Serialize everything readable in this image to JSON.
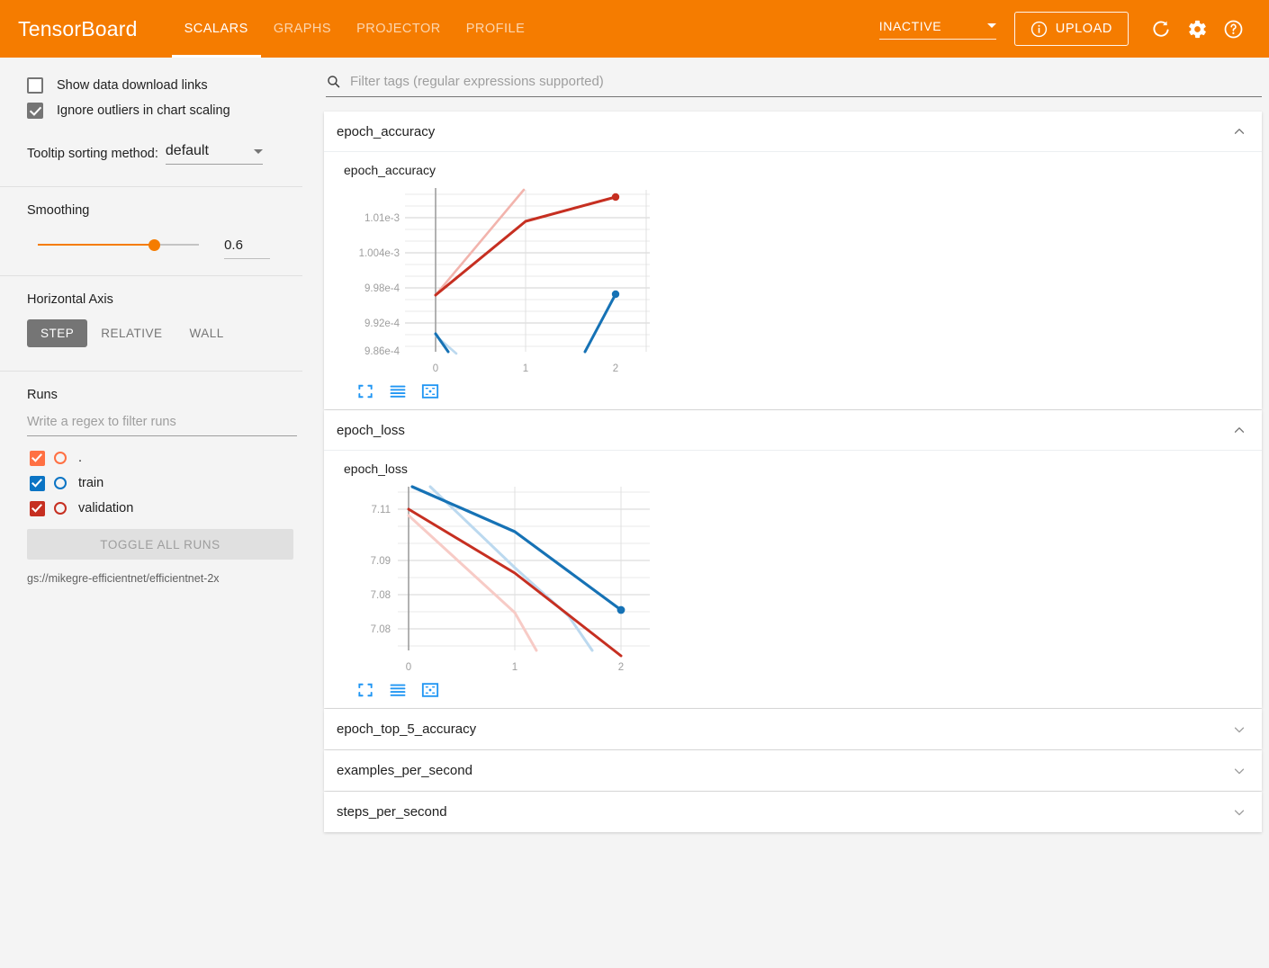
{
  "app": {
    "brand": "TensorBoard",
    "accent_color": "#f57c00",
    "background": "#f4f4f4"
  },
  "header": {
    "tabs": [
      {
        "label": "SCALARS",
        "active": true
      },
      {
        "label": "GRAPHS",
        "active": false
      },
      {
        "label": "PROJECTOR",
        "active": false
      },
      {
        "label": "PROFILE",
        "active": false
      }
    ],
    "run_selector": {
      "value": "INACTIVE",
      "icon": "chevron-down-icon"
    },
    "upload_label": "UPLOAD",
    "upload_icon": "info-circle-icon",
    "refresh_icon": "refresh-icon",
    "settings_icon": "gear-icon",
    "help_icon": "help-circle-icon"
  },
  "sidebar": {
    "checkboxes": [
      {
        "label": "Show data download links",
        "checked": false
      },
      {
        "label": "Ignore outliers in chart scaling",
        "checked": true
      }
    ],
    "tooltip": {
      "label": "Tooltip sorting method:",
      "value": "default",
      "icon": "chevron-down-icon"
    },
    "smoothing": {
      "title": "Smoothing",
      "value": "0.6"
    },
    "horizontal_axis": {
      "title": "Horizontal Axis",
      "options": [
        {
          "label": "STEP",
          "active": true
        },
        {
          "label": "RELATIVE",
          "active": false
        },
        {
          "label": "WALL",
          "active": false
        }
      ]
    },
    "runs": {
      "title": "Runs",
      "filter_placeholder": "Write a regex to filter runs",
      "items": [
        {
          "name": ".",
          "checked": true,
          "color": "#ff7043"
        },
        {
          "name": "train",
          "checked": true,
          "color": "#0b74c4"
        },
        {
          "name": "validation",
          "checked": true,
          "color": "#c62f21"
        }
      ],
      "toggle_all_label": "TOGGLE ALL RUNS",
      "logdir": "gs://mikegre-efficientnet/efficientnet-2x"
    }
  },
  "main": {
    "filter": {
      "icon": "search-icon",
      "placeholder": "Filter tags (regular expressions supported)"
    },
    "cards": [
      {
        "title": "epoch_accuracy",
        "expanded": true,
        "chevron": "chevron-up-icon",
        "chart_index": 0
      },
      {
        "title": "epoch_loss",
        "expanded": true,
        "chevron": "chevron-up-icon",
        "chart_index": 1
      },
      {
        "title": "epoch_top_5_accuracy",
        "expanded": false,
        "chevron": "chevron-down-icon"
      },
      {
        "title": "examples_per_second",
        "expanded": false,
        "chevron": "chevron-down-icon"
      },
      {
        "title": "steps_per_second",
        "expanded": false,
        "chevron": "chevron-down-icon"
      }
    ],
    "chart_toolbar": [
      {
        "icon": "expand-fullscreen-icon",
        "name": "toggle-expanded-button"
      },
      {
        "icon": "data-series-lines-icon",
        "name": "toggle-log-scale-button"
      },
      {
        "icon": "fit-domain-icon",
        "name": "reset-domain-button"
      }
    ]
  },
  "chart_data": [
    {
      "type": "line",
      "title": "epoch_accuracy",
      "xlabel": "",
      "ylabel": "",
      "x_ticks": [
        "0",
        "1",
        "2"
      ],
      "x": [
        0,
        1,
        2
      ],
      "xlim": [
        -0.12,
        2.12
      ],
      "y_ticks": [
        "1.01e-3",
        "1.004e-3",
        "9.98e-4",
        "9.92e-4",
        "9.86e-4"
      ],
      "y_tick_values": [
        0.00101,
        0.001004,
        0.000998,
        0.000992,
        0.000986
      ],
      "ylim": [
        0.0009805,
        0.0010135
      ],
      "grid": true,
      "legend": "none",
      "series": [
        {
          "name": "validation",
          "color": "#c62f21",
          "smoothed": true,
          "values": [
            0.0009968,
            0.0010093,
            0.0010125
          ]
        },
        {
          "name": "validation_raw",
          "color": "#f2b4ad",
          "smoothed": false,
          "values": [
            0.0009968,
            0.0010275,
            0.001061
          ]
        },
        {
          "name": "train",
          "color": "#1672b5",
          "smoothed": true,
          "values": [
            0.0009883,
            0.000966,
            0.0009965
          ]
        },
        {
          "name": "train_raw",
          "color": "#bcd9ef",
          "smoothed": false,
          "values": [
            0.0009883,
            0.00096,
            0.000993
          ]
        }
      ]
    },
    {
      "type": "line",
      "title": "epoch_loss",
      "xlabel": "",
      "ylabel": "",
      "x_ticks": [
        "0",
        "1",
        "2"
      ],
      "x": [
        0,
        1,
        2
      ],
      "xlim": [
        -0.13,
        2.13
      ],
      "y_ticks": [
        "7.11",
        "7.09",
        "7.08",
        "7.08"
      ],
      "y_tick_values": [
        7.11,
        7.095,
        7.085,
        7.078
      ],
      "ylim": [
        7.0705,
        7.1175
      ],
      "grid": true,
      "legend": "none",
      "series": [
        {
          "name": "train",
          "color": "#1672b5",
          "smoothed": true,
          "values": [
            7.1165,
            7.1005,
            7.0815
          ]
        },
        {
          "name": "train_raw",
          "color": "#bcd9ef",
          "smoothed": false,
          "values": [
            7.118,
            7.093,
            7.0655
          ]
        },
        {
          "name": "validation",
          "color": "#c62f21",
          "smoothed": true,
          "values": [
            7.1095,
            7.086,
            7.0675
          ]
        },
        {
          "name": "validation_raw",
          "color": "#f2b4ad",
          "smoothed": false,
          "values": [
            7.108,
            7.0775,
            7.053
          ]
        }
      ]
    }
  ]
}
